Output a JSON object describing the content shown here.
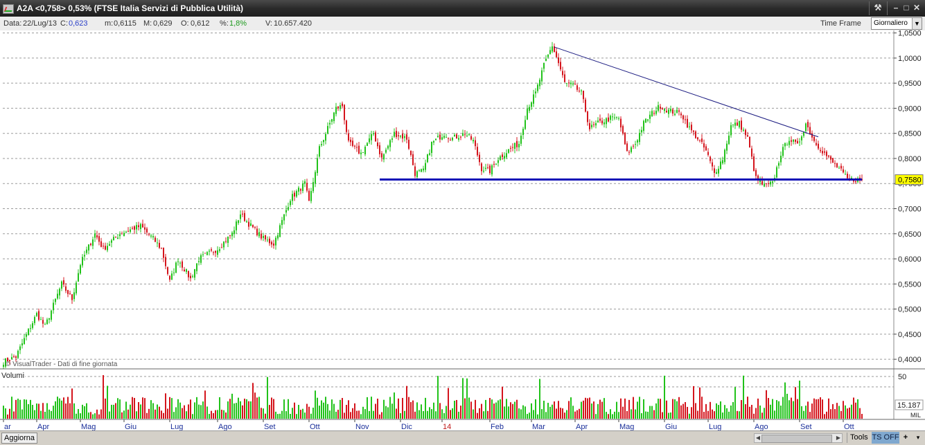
{
  "window": {
    "title": "A2A <0,758> 0,53%  (FTSE Italia Servizi di Pubblica Utilità)",
    "icons": [
      "chart-app-icon",
      "tools-icon",
      "minimize-icon",
      "maximize-icon",
      "close-icon"
    ]
  },
  "infobar": {
    "data_label": "Data:",
    "data_value": "22/Lug/13",
    "c_label": "C:",
    "c_value": "0,623",
    "m_label": "m:",
    "m_value": "0,6115",
    "M_label": "M:",
    "M_value": "0,629",
    "o_label": "O:",
    "o_value": "0,612",
    "pct_label": "%:",
    "pct_value": "1,8%",
    "v_label": "V:",
    "v_value": "10.657.420",
    "timeframe_label": "Time Frame",
    "timeframe_value": "Giornaliero"
  },
  "colors": {
    "up": "#21c21a",
    "down": "#d4141c",
    "support_line": "#0a0ab4",
    "trend_line": "#1a1a80",
    "price_tag": "#ffff00",
    "grid": "#9a9a9a"
  },
  "watermark": "© VisualTrader - Dati di fine giornata",
  "volume_label": "Volumi",
  "volume_scale_top": "50",
  "volume_readout": "15.187",
  "volume_unit": "MIL",
  "price_tag": "0,7580",
  "bottombar": {
    "aggiorna": "Aggiorna",
    "tools": "Tools",
    "ts": "TS OFF",
    "plus": "+",
    "dropdown": "▾"
  },
  "chart_data": {
    "type": "candlestick",
    "y_unit": "EUR",
    "ylim": [
      0.385,
      1.055
    ],
    "y_ticks": [
      "1,0500",
      "1,0000",
      "0,9500",
      "0,9000",
      "0,8500",
      "0,8000",
      "0,7500",
      "0,7000",
      "0,6500",
      "0,6000",
      "0,5500",
      "0,5000",
      "0,4500",
      "0,4000"
    ],
    "x_tick_labels": [
      "ar",
      "Apr",
      "Mag",
      "Giu",
      "Lug",
      "Ago",
      "Set",
      "Ott",
      "Nov",
      "Dic",
      "14",
      "Feb",
      "Mar",
      "Apr",
      "Mag",
      "Giu",
      "Lug",
      "Ago",
      "Set",
      "Ott"
    ],
    "x_ticks_at_index": [
      0,
      16,
      37,
      58,
      80,
      103,
      125,
      147,
      169,
      191,
      211,
      234,
      254,
      275,
      296,
      318,
      339,
      361,
      383,
      404
    ],
    "close_path_keypoints": [
      [
        0,
        0.395
      ],
      [
        6,
        0.405
      ],
      [
        10,
        0.44
      ],
      [
        16,
        0.49
      ],
      [
        20,
        0.465
      ],
      [
        28,
        0.55
      ],
      [
        33,
        0.52
      ],
      [
        37,
        0.59
      ],
      [
        44,
        0.65
      ],
      [
        48,
        0.62
      ],
      [
        56,
        0.65
      ],
      [
        62,
        0.66
      ],
      [
        66,
        0.665
      ],
      [
        72,
        0.64
      ],
      [
        76,
        0.62
      ],
      [
        80,
        0.555
      ],
      [
        84,
        0.6
      ],
      [
        90,
        0.56
      ],
      [
        94,
        0.6
      ],
      [
        103,
        0.62
      ],
      [
        110,
        0.65
      ],
      [
        114,
        0.69
      ],
      [
        118,
        0.67
      ],
      [
        125,
        0.64
      ],
      [
        130,
        0.63
      ],
      [
        138,
        0.72
      ],
      [
        145,
        0.75
      ],
      [
        147,
        0.71
      ],
      [
        152,
        0.82
      ],
      [
        156,
        0.86
      ],
      [
        160,
        0.9
      ],
      [
        163,
        0.905
      ],
      [
        166,
        0.83
      ],
      [
        172,
        0.81
      ],
      [
        178,
        0.85
      ],
      [
        182,
        0.8
      ],
      [
        188,
        0.85
      ],
      [
        194,
        0.84
      ],
      [
        198,
        0.77
      ],
      [
        202,
        0.775
      ],
      [
        206,
        0.83
      ],
      [
        212,
        0.85
      ],
      [
        216,
        0.84
      ],
      [
        222,
        0.85
      ],
      [
        226,
        0.835
      ],
      [
        230,
        0.78
      ],
      [
        234,
        0.775
      ],
      [
        238,
        0.8
      ],
      [
        244,
        0.82
      ],
      [
        248,
        0.83
      ],
      [
        252,
        0.9
      ],
      [
        256,
        0.93
      ],
      [
        260,
        0.985
      ],
      [
        264,
        1.025
      ],
      [
        267,
        0.99
      ],
      [
        270,
        0.95
      ],
      [
        274,
        0.945
      ],
      [
        278,
        0.93
      ],
      [
        282,
        0.86
      ],
      [
        286,
        0.87
      ],
      [
        292,
        0.88
      ],
      [
        296,
        0.88
      ],
      [
        300,
        0.81
      ],
      [
        304,
        0.83
      ],
      [
        308,
        0.87
      ],
      [
        312,
        0.89
      ],
      [
        316,
        0.905
      ],
      [
        320,
        0.895
      ],
      [
        326,
        0.89
      ],
      [
        330,
        0.86
      ],
      [
        334,
        0.84
      ],
      [
        338,
        0.815
      ],
      [
        342,
        0.77
      ],
      [
        346,
        0.8
      ],
      [
        350,
        0.865
      ],
      [
        354,
        0.87
      ],
      [
        358,
        0.84
      ],
      [
        362,
        0.76
      ],
      [
        366,
        0.745
      ],
      [
        370,
        0.75
      ],
      [
        374,
        0.81
      ],
      [
        378,
        0.84
      ],
      [
        382,
        0.825
      ],
      [
        386,
        0.87
      ],
      [
        390,
        0.835
      ],
      [
        394,
        0.815
      ],
      [
        398,
        0.795
      ],
      [
        402,
        0.78
      ],
      [
        406,
        0.758
      ]
    ],
    "annotations": {
      "support_line": {
        "x_start": 181,
        "x_end": 413,
        "y": 0.758
      },
      "trend_line": {
        "x_start": 265,
        "y_start": 1.022,
        "x_end": 392,
        "y_end": 0.843
      }
    },
    "volume": {
      "ylim": [
        0,
        50
      ],
      "notes": "random-looking daily volume bars up to ~50 MIL, colored by candle direction"
    }
  }
}
